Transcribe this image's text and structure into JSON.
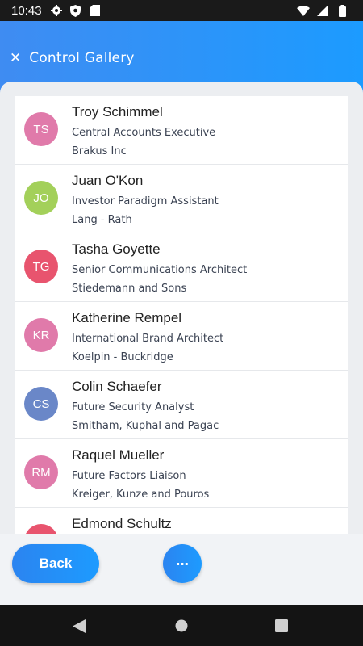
{
  "status_bar": {
    "time": "10:43",
    "icons": [
      "settings-icon",
      "shield-icon",
      "sd-card-icon",
      "wifi-icon",
      "signal-icon",
      "battery-icon"
    ]
  },
  "header": {
    "close_icon": "close-icon",
    "title": "Control Gallery",
    "gradient_start": "#3f8cf2",
    "gradient_end": "#1c9bff"
  },
  "contacts": [
    {
      "initials": "TS",
      "name": "Troy Schimmel",
      "title": "Central Accounts Executive",
      "company": "Brakus Inc",
      "color": "#e07aaa"
    },
    {
      "initials": "JO",
      "name": "Juan O'Kon",
      "title": "Investor Paradigm Assistant",
      "company": "Lang - Rath",
      "color": "#a3d05a"
    },
    {
      "initials": "TG",
      "name": "Tasha Goyette",
      "title": "Senior Communications Architect",
      "company": "Stiedemann and Sons",
      "color": "#e8546e"
    },
    {
      "initials": "KR",
      "name": "Katherine Rempel",
      "title": "International Brand Architect",
      "company": "Koelpin - Buckridge",
      "color": "#e07aaa"
    },
    {
      "initials": "CS",
      "name": "Colin Schaefer",
      "title": "Future Security Analyst",
      "company": "Smitham, Kuphal and Pagac",
      "color": "#6a87c8"
    },
    {
      "initials": "RM",
      "name": "Raquel Mueller",
      "title": "Future Factors Liaison",
      "company": "Kreiger, Kunze and Pouros",
      "color": "#e07aaa"
    },
    {
      "initials": "",
      "name": "Edmond Schultz",
      "title": "",
      "company": "",
      "color": "#e8546e"
    }
  ],
  "buttons": {
    "back": "Back",
    "more": "⋯"
  },
  "nav": [
    "back-icon",
    "home-icon",
    "recents-icon"
  ]
}
